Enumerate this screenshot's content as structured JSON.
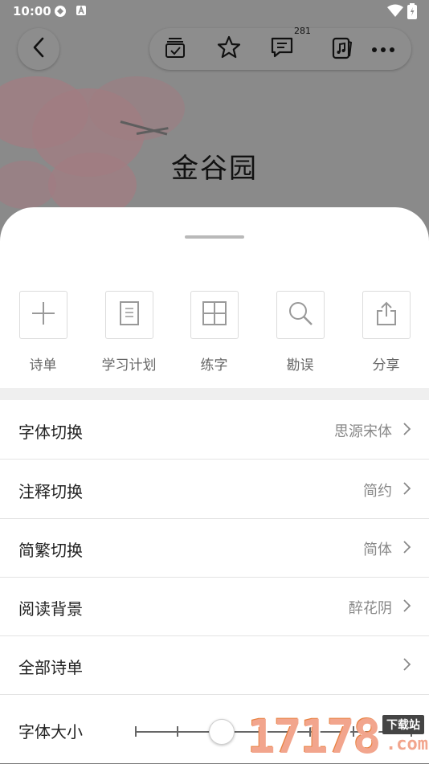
{
  "status_bar": {
    "time": "10:00"
  },
  "toolbar": {
    "comment_count": "281"
  },
  "poem": {
    "title": "金谷园"
  },
  "actions": [
    {
      "label": "诗单",
      "icon": "plus-icon"
    },
    {
      "label": "学习计划",
      "icon": "document-icon"
    },
    {
      "label": "练字",
      "icon": "grid-icon"
    },
    {
      "label": "勘误",
      "icon": "magnifier-icon"
    },
    {
      "label": "分享",
      "icon": "share-icon"
    }
  ],
  "settings": [
    {
      "label": "字体切换",
      "value": "思源宋体"
    },
    {
      "label": "注释切换",
      "value": "简约"
    },
    {
      "label": "简繁切换",
      "value": "简体"
    },
    {
      "label": "阅读背景",
      "value": "醉花阴"
    },
    {
      "label": "全部诗单",
      "value": ""
    }
  ],
  "font_size": {
    "label": "字体大小",
    "level_fraction": 0.31
  },
  "watermark": {
    "number": "17178",
    "tag": "下载站",
    "suffix": ".com"
  },
  "colors": {
    "accent": "#e8803e",
    "sheet": "#ffffff",
    "overlay": "#7b7b7b"
  }
}
